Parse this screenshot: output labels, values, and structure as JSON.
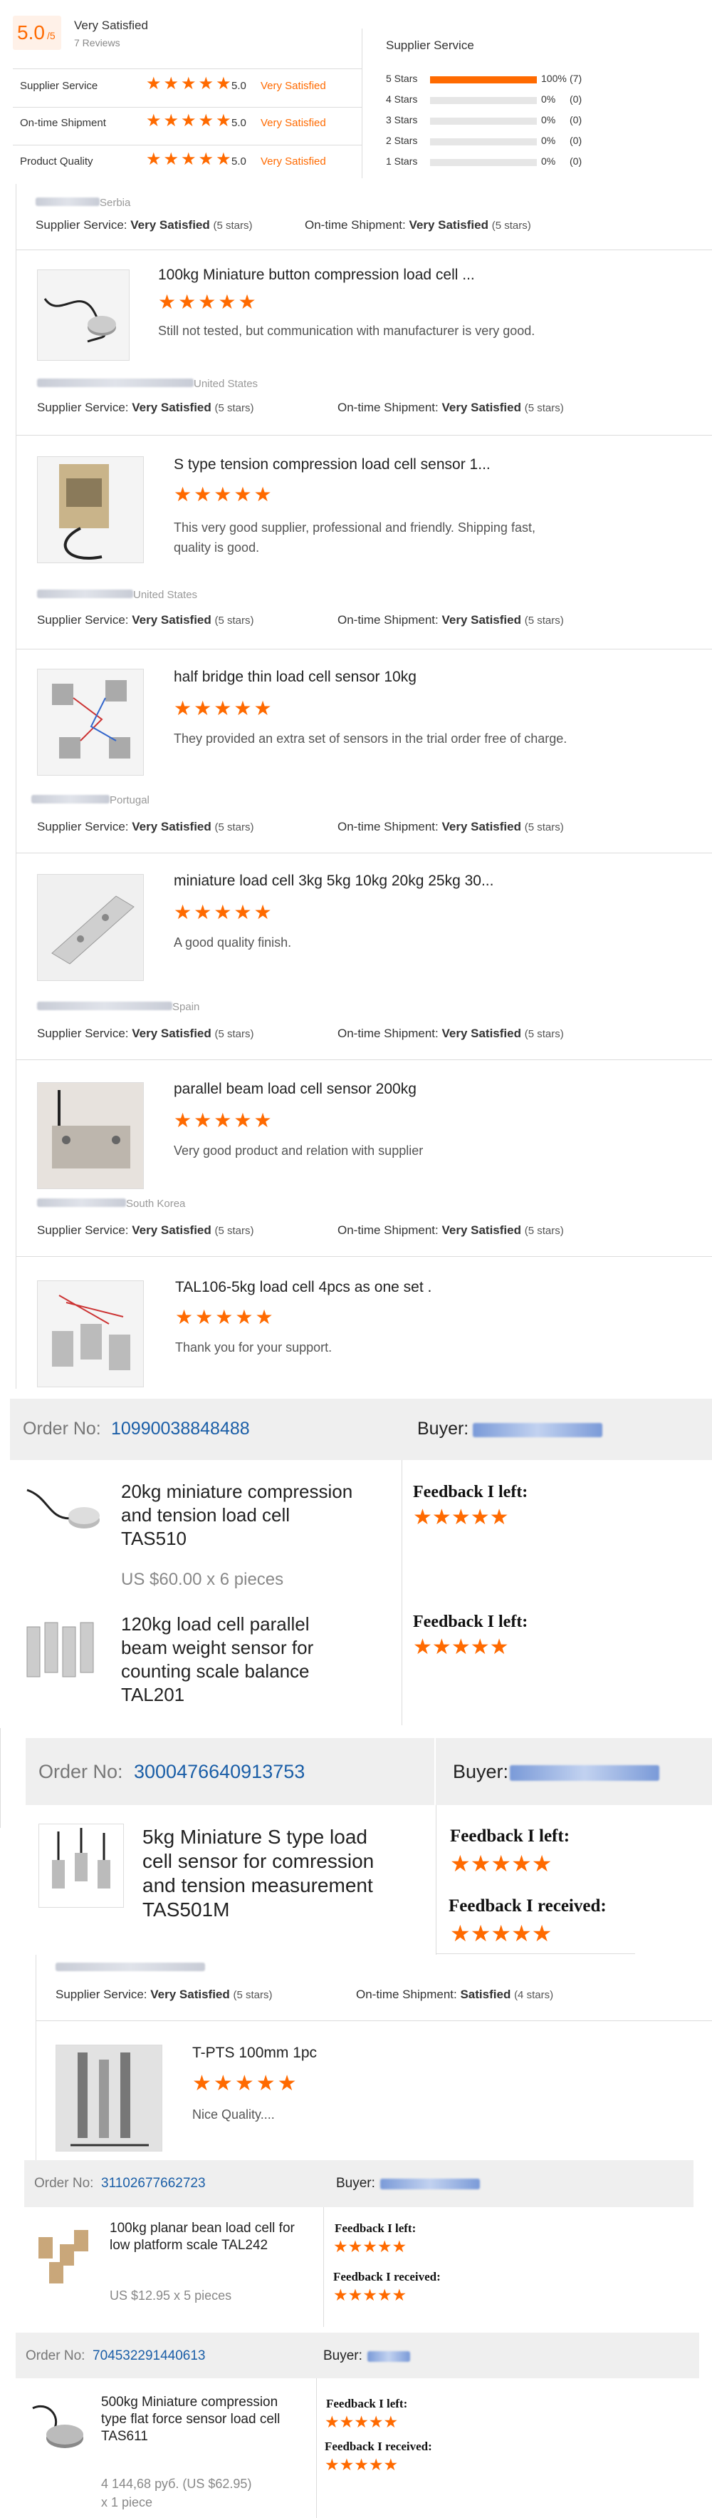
{
  "summary": {
    "score": "5.0",
    "score_suffix": "/5",
    "rating_text": "Very Satisfied",
    "reviews": "7 Reviews",
    "rows": [
      {
        "label": "Supplier Service",
        "value": "5.0",
        "text": "Very Satisfied"
      },
      {
        "label": "On-time Shipment",
        "value": "5.0",
        "text": "Very Satisfied"
      },
      {
        "label": "Product Quality",
        "value": "5.0",
        "text": "Very Satisfied"
      }
    ],
    "dist_title": "Supplier Service",
    "dist": [
      {
        "label": "5 Stars",
        "pct": "100%",
        "count": "(7)",
        "fill": 1.0
      },
      {
        "label": "4 Stars",
        "pct": "0%",
        "count": "(0)",
        "fill": 0
      },
      {
        "label": "3 Stars",
        "pct": "0%",
        "count": "(0)",
        "fill": 0
      },
      {
        "label": "2 Stars",
        "pct": "0%",
        "count": "(0)",
        "fill": 0
      },
      {
        "label": "1 Stars",
        "pct": "0%",
        "count": "(0)",
        "fill": 0
      }
    ]
  },
  "labels": {
    "supplier_service": "Supplier Service:",
    "ontime": "On-time Shipment:",
    "very_satisfied": "Very Satisfied",
    "satisfied": "Satisfied",
    "five_stars": "(5 stars)",
    "four_stars": "(4 stars)",
    "order_no": "Order No:",
    "buyer": "Buyer:",
    "feedback_left": "Feedback I left:",
    "feedback_received": "Feedback I received:"
  },
  "reviews": [
    {
      "loc": "Serbia"
    },
    {
      "loc": "United States",
      "title": "100kg Miniature button compression load cell ...",
      "comment": "Still not tested, but communication with manufacturer is very good."
    },
    {
      "loc": "United States",
      "title": "S type tension compression load cell sensor 1...",
      "comment": "This very good supplier, professional and friendly. Shipping fast, quality is good."
    },
    {
      "loc": "Portugal",
      "title": "half bridge thin load cell sensor 10kg",
      "comment": "They provided an extra set of sensors in the trial order free of charge."
    },
    {
      "loc": "Spain",
      "title": "miniature load cell 3kg 5kg 10kg 20kg 25kg 30...",
      "comment": "A good quality finish."
    },
    {
      "loc": "South Korea",
      "title": "parallel beam load cell sensor 200kg",
      "comment": "Very good product and relation with supplier"
    },
    {
      "title": "TAL106-5kg load cell 4pcs as one set .",
      "comment": "Thank you for your support."
    }
  ],
  "order1": {
    "no": "10990038848488",
    "items": [
      {
        "title": "20kg miniature compression and tension load cell TAS510",
        "price": "US $60.00 x 6 pieces"
      },
      {
        "title": "120kg load cell parallel beam weight sensor for counting scale balance TAL201"
      }
    ]
  },
  "order2": {
    "no": "3000476640913753",
    "title": "5kg Miniature S type load cell sensor for comression and tension measurement TAS501M"
  },
  "review8": {
    "title": "T-PTS 100mm 1pc",
    "comment": "Nice Quality...."
  },
  "order3": {
    "no": "31102677662723",
    "title": "100kg planar bean load cell for low platform scale TAL242",
    "price": "US $12.95 x 5 pieces"
  },
  "order4": {
    "no": "704532291440613",
    "title": "500kg Miniature compression type flat force sensor load cell TAS611",
    "price": "4 144,68 руб. (US $62.95)",
    "qty": "x 1 piece"
  },
  "colors": {
    "accent": "#ff6a00",
    "link": "#1a5ea7"
  }
}
